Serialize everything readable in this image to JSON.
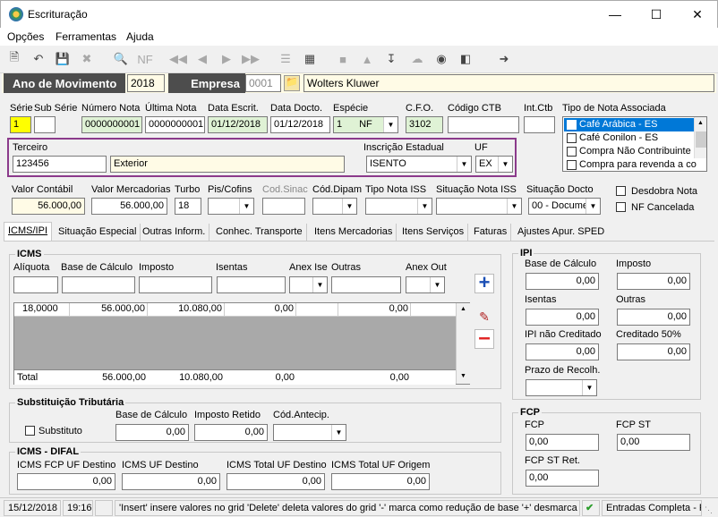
{
  "window": {
    "title": "Escrituração"
  },
  "menu": [
    "Opções",
    "Ferramentas",
    "Ajuda"
  ],
  "header": {
    "ano_label": "Ano de Movimento",
    "ano_value": "2018",
    "empresa_label": "Empresa",
    "empresa_code": "0001",
    "empresa_name": "Wolters Kluwer"
  },
  "nota": {
    "serie_label": "Série",
    "serie_value": "1",
    "subserie_label": "Sub Série",
    "subserie_value": "",
    "numero_label": "Número Nota",
    "numero_value": "0000000001",
    "ultima_label": "Última Nota",
    "ultima_value": "0000000001",
    "escrit_label": "Data Escrit.",
    "escrit_value": "01/12/2018",
    "docto_label": "Data Docto.",
    "docto_value": "01/12/2018",
    "especie_label": "Espécie",
    "especie_num": "1",
    "especie_value": "NF",
    "cfo_label": "C.F.O.",
    "cfo_value": "3102",
    "ctb_label": "Código CTB",
    "ctb_value": "",
    "intctb_label": "Int.Ctb",
    "intctb_value": "",
    "tipo_label": "Tipo de Nota Associada",
    "tipo_items": [
      "Café Arábica - ES",
      "Café Conilon - ES",
      "Compra Não Contribuinte",
      "Compra para revenda a co"
    ]
  },
  "terceiro": {
    "label": "Terceiro",
    "code": "123456",
    "name": "Exterior",
    "ie_label": "Inscrição Estadual",
    "ie_value": "ISENTO",
    "uf_label": "UF",
    "uf_value": "EX"
  },
  "valores": {
    "contabil_label": "Valor Contábil",
    "contabil_value": "56.000,00",
    "merc_label": "Valor Mercadorias",
    "merc_value": "56.000,00",
    "turbo_label": "Turbo",
    "turbo_value": "18",
    "pis_label": "Pis/Cofins",
    "sinac_label": "Cod.Sinac",
    "dipam_label": "Cód.Dipam",
    "iss_label": "Tipo Nota ISS",
    "sitiss_label": "Situação Nota ISS",
    "sitdoc_label": "Situação Docto",
    "sitdoc_value": "00 - Documen",
    "desdobra_label": "Desdobra Nota",
    "cancelada_label": "NF Cancelada"
  },
  "tabs": [
    "ICMS/IPI",
    "Situação Especial",
    "Outras Inform.",
    "Conhec. Transporte",
    "Itens Mercadorias",
    "Itens Serviços",
    "Faturas",
    "Ajustes Apur. SPED"
  ],
  "icms": {
    "title": "ICMS",
    "aliquota": "Alíquota",
    "base": "Base de Cálculo",
    "imposto": "Imposto",
    "isentas": "Isentas",
    "anexise": "Anex Ise",
    "outras": "Outras",
    "anexout": "Anex Out",
    "row": [
      "18,0000",
      "56.000,00",
      "10.080,00",
      "0,00",
      "",
      "0,00",
      ""
    ],
    "total_label": "Total",
    "total": [
      "56.000,00",
      "10.080,00",
      "0,00",
      "",
      "0,00",
      ""
    ]
  },
  "st": {
    "title": "Substituição Tributária",
    "substituto": "Substituto",
    "base_label": "Base de Cálculo",
    "base": "0,00",
    "retido_label": "Imposto Retido",
    "retido": "0,00",
    "antecip_label": "Cód.Antecip."
  },
  "difal": {
    "title": "ICMS - DIFAL",
    "fcp_label": "ICMS FCP UF Destino",
    "fcp": "0,00",
    "uf_label": "ICMS UF Destino",
    "uf": "0,00",
    "total_label": "ICMS Total UF Destino",
    "total": "0,00",
    "orig_label": "ICMS Total UF Origem",
    "orig": "0,00"
  },
  "ipi": {
    "title": "IPI",
    "base_label": "Base de Cálculo",
    "base": "0,00",
    "imposto_label": "Imposto",
    "imposto": "0,00",
    "isentas_label": "Isentas",
    "isentas": "0,00",
    "outras_label": "Outras",
    "outras": "0,00",
    "nao_label": "IPI não Creditado",
    "nao": "0,00",
    "cred_label": "Creditado 50%",
    "cred": "0,00",
    "prazo_label": "Prazo de Recolh."
  },
  "fcp": {
    "title": "FCP",
    "fcp_label": "FCP",
    "fcp": "0,00",
    "st_label": "FCP ST",
    "st": "0,00",
    "ret_label": "FCP ST Ret.",
    "ret": "0,00"
  },
  "status": {
    "date": "15/12/2018",
    "time": "19:16",
    "message": "'Insert' insere valores no grid 'Delete' deleta valores do grid '-' marca como redução de base '+' desmarca re",
    "mode": "Entradas Completa - P"
  }
}
